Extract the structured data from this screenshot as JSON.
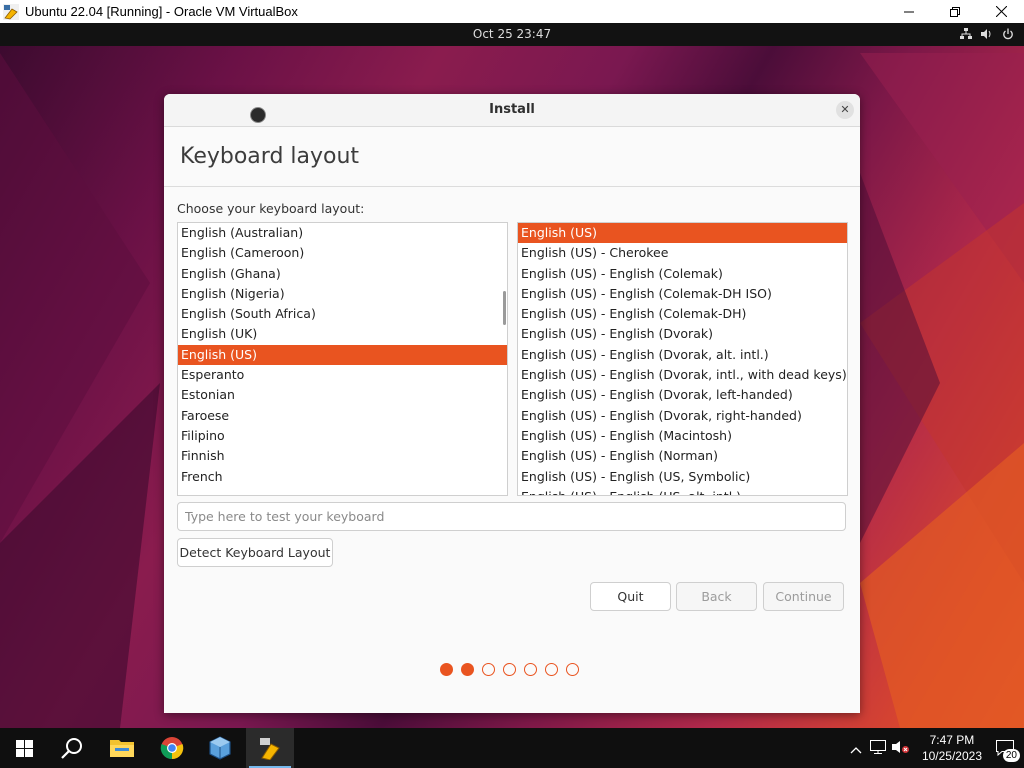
{
  "window": {
    "title": "Ubuntu 22.04 [Running] - Oracle VM VirtualBox"
  },
  "gnome": {
    "clock": "Oct 25  23:47"
  },
  "dialog": {
    "title": "Install",
    "page_title": "Keyboard layout",
    "prompt": "Choose your keyboard layout:",
    "layouts": [
      "English (Australian)",
      "English (Cameroon)",
      "English (Ghana)",
      "English (Nigeria)",
      "English (South Africa)",
      "English (UK)",
      "English (US)",
      "Esperanto",
      "Estonian",
      "Faroese",
      "Filipino",
      "Finnish",
      "French"
    ],
    "selected_layout": "English (US)",
    "variants": [
      "English (US)",
      "English (US) - Cherokee",
      "English (US) - English (Colemak)",
      "English (US) - English (Colemak-DH ISO)",
      "English (US) - English (Colemak-DH)",
      "English (US) - English (Dvorak)",
      "English (US) - English (Dvorak, alt. intl.)",
      "English (US) - English (Dvorak, intl., with dead keys)",
      "English (US) - English (Dvorak, left-handed)",
      "English (US) - English (Dvorak, right-handed)",
      "English (US) - English (Macintosh)",
      "English (US) - English (Norman)",
      "English (US) - English (US, Symbolic)",
      "English (US) - English (US, alt. intl.)"
    ],
    "selected_variant": "English (US)",
    "test_placeholder": "Type here to test your keyboard",
    "detect_button": "Detect Keyboard Layout",
    "quit_button": "Quit",
    "back_button": "Back",
    "continue_button": "Continue",
    "progress": {
      "total_steps": 7,
      "completed_steps": 2
    }
  },
  "taskbar": {
    "time": "7:47 PM",
    "date": "10/25/2023",
    "notification_count": "20"
  },
  "colors": {
    "accent": "#e95420",
    "topbar": "#121212",
    "taskbar": "#0f0f0f"
  }
}
